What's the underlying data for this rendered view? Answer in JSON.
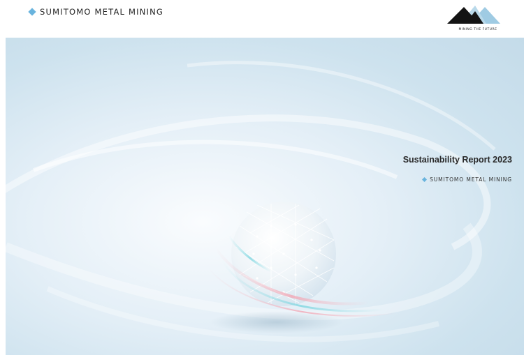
{
  "header": {
    "brand": "SUMITOMO METAL MINING",
    "logo_tagline": "MINING THE FUTURE"
  },
  "cover": {
    "title": "Sustainability Report 2023",
    "company": "SUMITOMO METAL MINING"
  },
  "colors": {
    "brand_diamond": "#69b4de",
    "logo_dark": "#141414",
    "logo_light": "#9fcbe3",
    "background_light": "#e4eff7"
  }
}
